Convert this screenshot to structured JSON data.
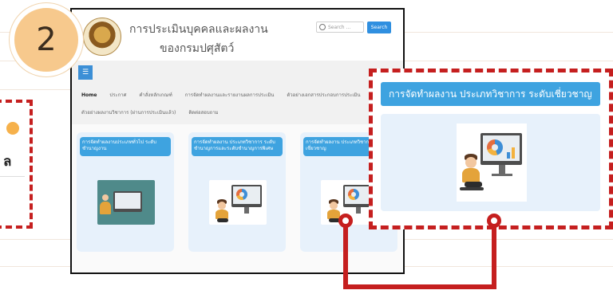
{
  "step": {
    "number": "2"
  },
  "left_callout": {
    "fragment": "ล"
  },
  "site": {
    "title_line1": "การประเมินบุคคลและผลงาน",
    "title_line2": "ของกรมปศุสัตว์",
    "search": {
      "placeholder": "Search ...",
      "button_label": "Search"
    },
    "menu_icon": "☰",
    "nav_row1": [
      "Home",
      "ประกาศ",
      "คำสั่งหลักเกณฑ์",
      "การจัดทำผลงานและรายงานผลการประเมิน",
      "ตัวอย่างเอกสารประกอบการประเมิน"
    ],
    "nav_row2": [
      "ตัวอย่างผลงานวิชาการ (ผ่านการประเมินแล้ว)",
      "ติดต่อสอบถาม"
    ],
    "cards": [
      {
        "title": "การจัดทำผลงานประเภททั่วไป ระดับชำนาญงาน"
      },
      {
        "title": "การจัดทำผลงาน ประเภทวิชาการ ระดับชำนาญการและระดับชำนาญการพิเศษ"
      },
      {
        "title": "การจัดทำผลงาน ประเภทวิชาการ ระดับเชี่ยวชาญ"
      }
    ]
  },
  "zoom": {
    "title": "การจัดทำผลงาน ประเภทวิชาการ ระดับเชี่ยวชาญ"
  },
  "colors": {
    "accent_red": "#c51f1f",
    "card_blue": "#3ea3e0",
    "badge": "#f7c98d"
  }
}
